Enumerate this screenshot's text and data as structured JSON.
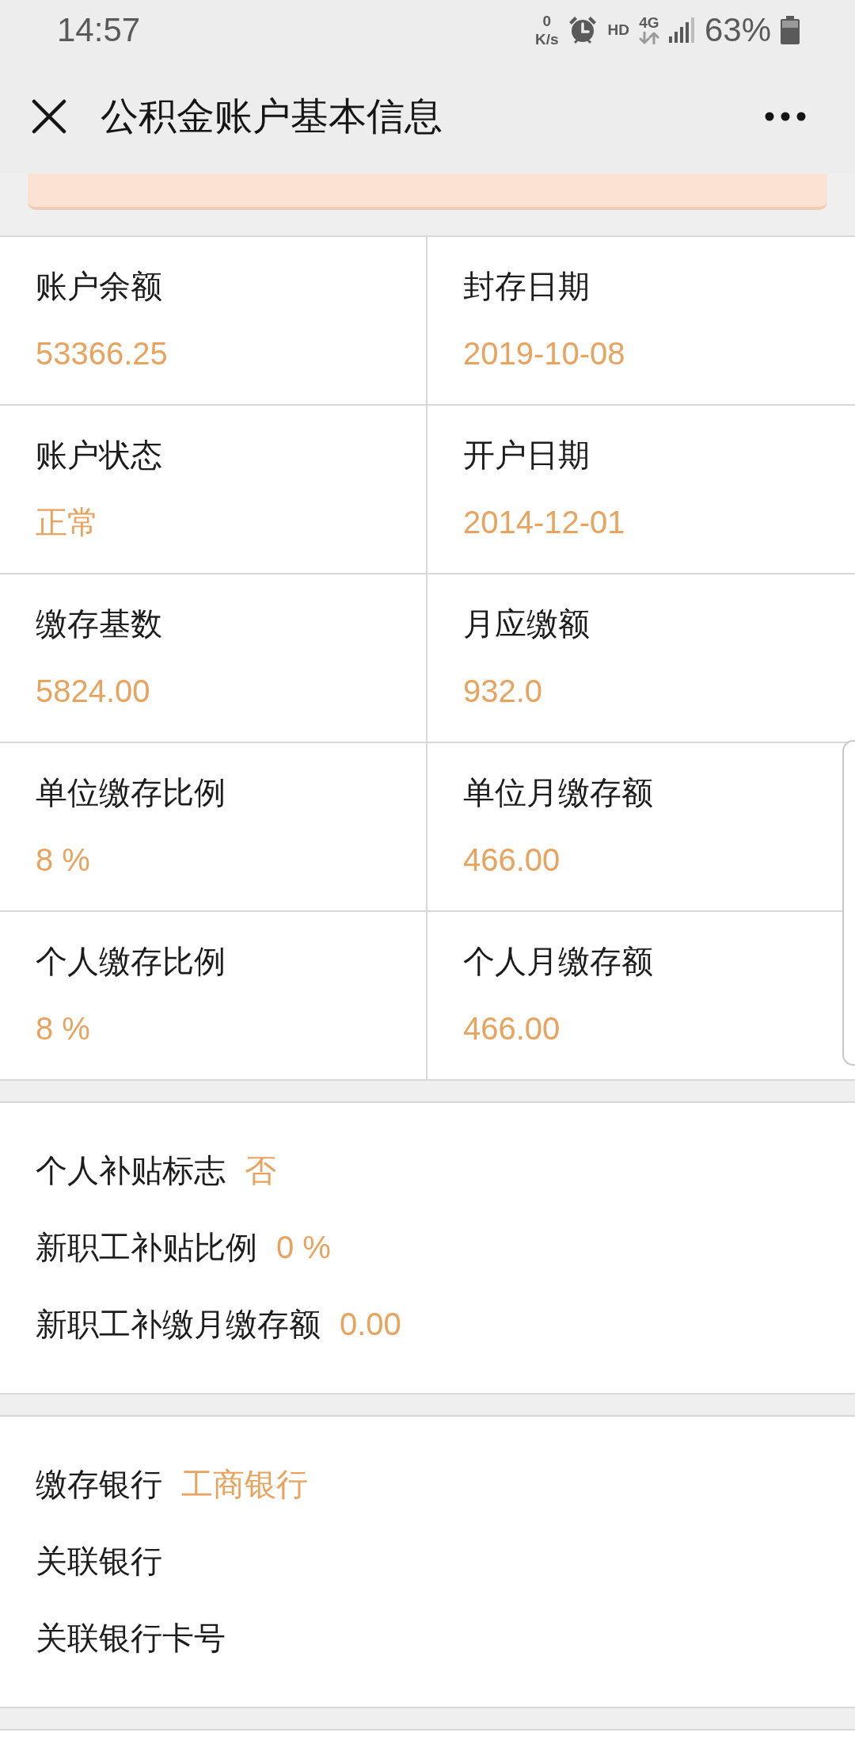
{
  "status_bar": {
    "time": "14:57",
    "net_speed_value": "0",
    "net_speed_unit": "K/s",
    "hd_label": "HD",
    "network_type": "4G",
    "battery": "63%"
  },
  "header": {
    "title": "公积金账户基本信息"
  },
  "account_grid": [
    {
      "label": "账户余额",
      "value": "53366.25"
    },
    {
      "label": "封存日期",
      "value": "2019-10-08"
    },
    {
      "label": "账户状态",
      "value": "正常"
    },
    {
      "label": "开户日期",
      "value": "2014-12-01"
    },
    {
      "label": "缴存基数",
      "value": "5824.00"
    },
    {
      "label": "月应缴额",
      "value": "932.0"
    },
    {
      "label": "单位缴存比例",
      "value": "8 %"
    },
    {
      "label": "单位月缴存额",
      "value": "466.00"
    },
    {
      "label": "个人缴存比例",
      "value": "8 %"
    },
    {
      "label": "个人月缴存额",
      "value": "466.00"
    }
  ],
  "sections": [
    {
      "rows": [
        {
          "label": "个人补贴标志",
          "value": "否"
        },
        {
          "label": "新职工补贴比例",
          "value": "0 %"
        },
        {
          "label": "新职工补缴月缴存额",
          "value": "0.00"
        }
      ]
    },
    {
      "rows": [
        {
          "label": "缴存银行",
          "value": "工商银行"
        },
        {
          "label": "关联银行"
        },
        {
          "label": "关联银行卡号"
        }
      ]
    }
  ]
}
